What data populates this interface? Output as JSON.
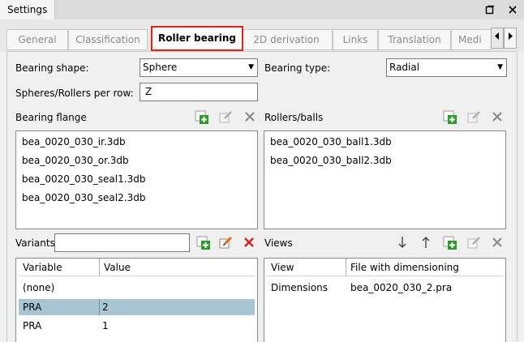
{
  "window": {
    "title": "Settings"
  },
  "tabs": [
    "General",
    "Classification",
    "Roller bearing",
    "2D derivation",
    "Links",
    "Translation",
    "Medi"
  ],
  "form": {
    "bearing_shape_label": "Bearing shape:",
    "bearing_shape_value": "Sphere",
    "bearing_type_label": "Bearing type:",
    "bearing_type_value": "Radial",
    "per_row_label": "Spheres/Rollers per row:",
    "per_row_value": "Z"
  },
  "bearing_flange": {
    "label": "Bearing flange",
    "items": [
      "bea_0020_030_ir.3db",
      "bea_0020_030_or.3db",
      "bea_0020_030_seal1.3db",
      "bea_0020_030_seal2.3db"
    ]
  },
  "rollers": {
    "label": "Rollers/balls",
    "items": [
      "bea_0020_030_ball1.3db",
      "bea_0020_030_ball2.3db"
    ]
  },
  "variants": {
    "label": "Variants",
    "search_value": "",
    "columns": [
      "Variable",
      "Value"
    ],
    "rows": [
      {
        "variable": "(none)",
        "value": ""
      },
      {
        "variable": "PRA",
        "value": "2"
      },
      {
        "variable": "PRA",
        "value": "1"
      }
    ]
  },
  "views": {
    "label": "Views",
    "columns": [
      "View",
      "File with dimensioning"
    ],
    "rows": [
      {
        "view": "Dimensions",
        "file": "bea_0020_030_2.pra"
      }
    ]
  },
  "colors": {
    "active_tab_border": "#e32119",
    "selected_row": "#a8c5d3"
  }
}
